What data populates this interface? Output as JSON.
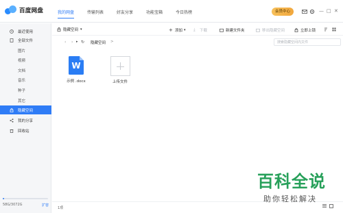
{
  "app": {
    "name": "百度网盘",
    "vip_label": "会员中心"
  },
  "nav": {
    "items": [
      "我的网盘",
      "传输列表",
      "好友分享",
      "功能宝箱",
      "今日热榜"
    ]
  },
  "window_controls": [
    "—",
    "□",
    "✕"
  ],
  "sidebar": {
    "items": [
      {
        "label": "最近使用",
        "icon": "clock-icon"
      },
      {
        "label": "全部文件",
        "icon": "file-icon"
      },
      {
        "label": "隐藏空间",
        "icon": "lock-icon",
        "active": true
      },
      {
        "label": "我的分享",
        "icon": "share-icon"
      },
      {
        "label": "回收站",
        "icon": "trash-icon"
      }
    ],
    "subitems": [
      "图片",
      "视频",
      "文档",
      "音乐",
      "种子",
      "其它"
    ],
    "quota_text": "58G/3072G",
    "quota_fraction": 0.019,
    "expand_label": "扩容"
  },
  "toolbar": {
    "path_label": "隐藏空间",
    "buttons": [
      {
        "label": "添加",
        "icon": "plus-icon",
        "disabled": false
      },
      {
        "label": "下载",
        "icon": "download-icon",
        "disabled": true
      },
      {
        "label": "新建文件夹",
        "icon": "folder-add-icon",
        "disabled": false
      },
      {
        "label": "移出隐藏空间",
        "icon": "move-out-icon",
        "disabled": true
      },
      {
        "label": "立即上锁",
        "icon": "lock-icon",
        "disabled": false
      }
    ]
  },
  "breadcrumb": {
    "current": "隐藏空间",
    "separator": ">"
  },
  "search": {
    "placeholder": "搜索隐藏空间内文件"
  },
  "files": [
    {
      "name": "示例 .docx",
      "icon": "word-doc-icon",
      "letter": "W"
    },
    {
      "name": "上传文件",
      "icon": "upload-plus-icon"
    }
  ],
  "status": {
    "count": "1项"
  },
  "watermark": {
    "title": "百科全说",
    "subtitle": "助你轻松解决"
  },
  "colors": {
    "accent": "#2f7cf6",
    "vip": "#f1a73c",
    "watermark": "#27a05a"
  }
}
